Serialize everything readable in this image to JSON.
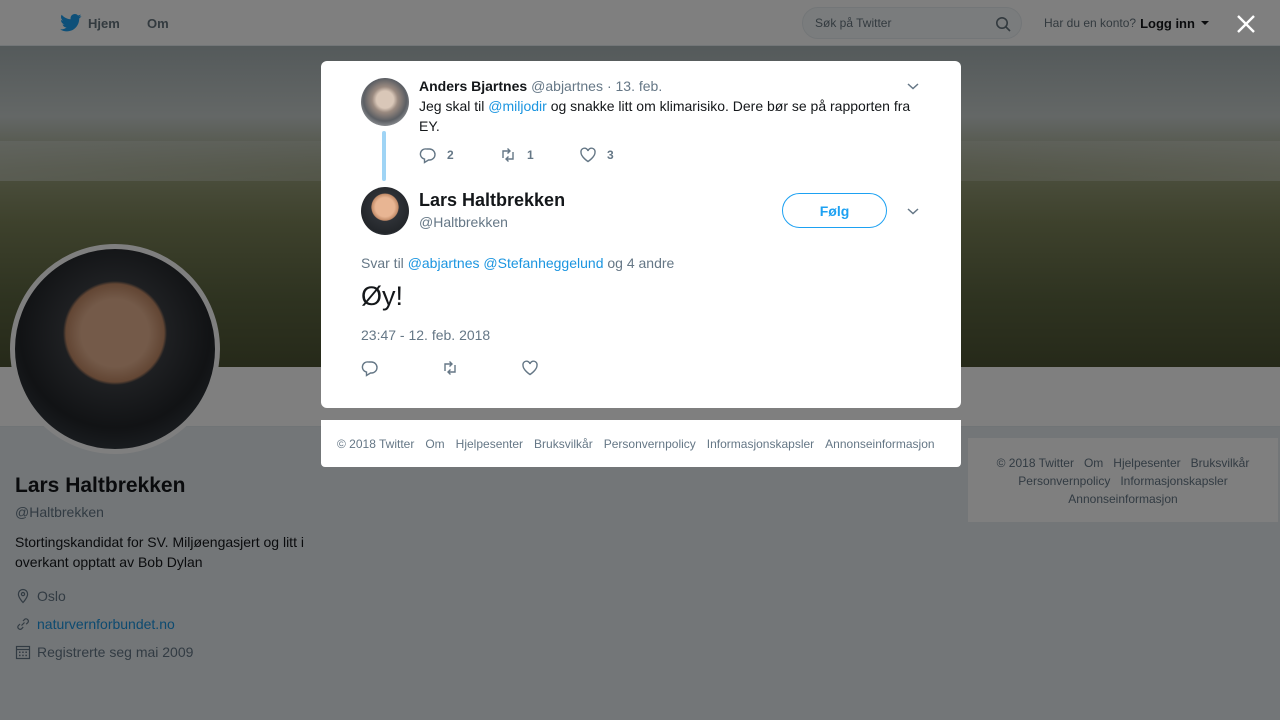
{
  "topbar": {
    "home_label": "Hjem",
    "about_label": "Om",
    "search_placeholder": "Søk på Twitter",
    "login_question": "Har du en konto?",
    "login_label": "Logg inn"
  },
  "profile": {
    "name": "Lars Haltbrekken",
    "handle": "@Haltbrekken",
    "bio": "Stortingskandidat for SV. Miljøengasjert og litt i overkant opptatt av Bob Dylan",
    "location": "Oslo",
    "website": "naturvernforbundet.no",
    "joined": "Registrerte seg mai 2009"
  },
  "parent_tweet": {
    "name": "Anders Bjartnes",
    "handle": "@abjartnes",
    "date": "· 13. feb.",
    "text_before": "Jeg skal til ",
    "mention": "@miljodir",
    "text_after": " og snakke litt om klimarisiko. Dere bør se på rapporten fra EY.",
    "replies": "2",
    "retweets": "1",
    "likes": "3"
  },
  "main_tweet": {
    "name": "Lars Haltbrekken",
    "handle": "@Haltbrekken",
    "follow_label": "Følg",
    "reply_prefix": "Svar til",
    "reply_mention_1": "@abjartnes",
    "reply_mention_2": "@Stefanheggelund",
    "reply_suffix": "og 4 andre",
    "text": "Øy!",
    "timestamp": "23:47 - 12. feb. 2018"
  },
  "footer_links": [
    "© 2018 Twitter",
    "Om",
    "Hjelpesenter",
    "Bruksvilkår",
    "Personvernpolicy",
    "Informasjonskapsler",
    "Annonseinformasjon"
  ],
  "colors": {
    "accent": "#1da1f2",
    "link": "#1b95e0",
    "thread_line": "#9fd4f5",
    "overlay": "rgba(0,0,0,0.5)"
  }
}
